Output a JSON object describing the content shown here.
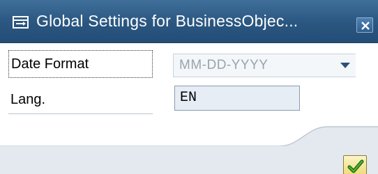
{
  "window": {
    "title": "Global Settings for BusinessObjec...",
    "close_icon": "close-icon",
    "title_icon": "dialog-icon"
  },
  "form": {
    "date_format": {
      "label": "Date Format",
      "value": "MM-DD-YYYY",
      "icon": "dropdown-arrow-icon"
    },
    "language": {
      "label": "Lang.",
      "value": "EN"
    }
  },
  "footer": {
    "confirm_icon": "checkmark-icon"
  },
  "colors": {
    "titlebar": "#2a5680",
    "form_bg": "#ffffff",
    "input_bg": "#e6edf5",
    "confirm_bg": "#eed86c",
    "check": "#2f8a1e"
  }
}
